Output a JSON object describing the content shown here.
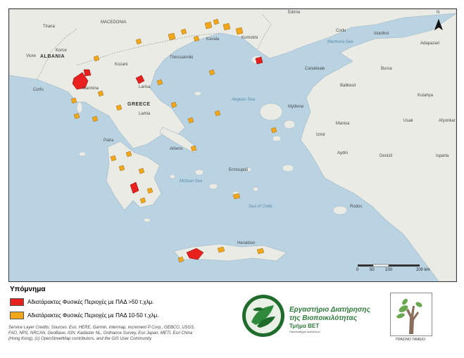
{
  "map": {
    "north_arrow": "N",
    "countries": {
      "albania": "ALBANIA",
      "greece": "GREECE"
    },
    "seas": [
      "Marmara Sea",
      "Aegean Sea",
      "Mirtoan Sea",
      "Sea of Crete"
    ],
    "places": [
      "Edirne",
      "MACEDONIA",
      "Tirana",
      "Istanbul",
      "Corlu",
      "Komotini",
      "Kavala",
      "Thessaloniki",
      "Adapazari",
      "Bursa",
      "Canakkale",
      "Balikesir",
      "Kutahya",
      "Usak",
      "Afyonkar",
      "Izmir",
      "Mytilene",
      "Manisa",
      "Aydin",
      "Denizli",
      "Isparta",
      "Larisa",
      "Lamia",
      "Korce",
      "Vlore",
      "Ioannina",
      "Corfu",
      "Kozani",
      "Patra",
      "Athens",
      "Ermoupoli",
      "Rodos",
      "Heraklion"
    ],
    "scale": {
      "labels": [
        "0",
        "50",
        "100",
        "200 km"
      ]
    }
  },
  "legend": {
    "title": "Υπόμνημα",
    "items": [
      {
        "label": "Αδιατάρακτες Φυσικές Περιοχές με ΠΑΔ >50 τ.χλμ.",
        "color": "#e8201e"
      },
      {
        "label": "Αδιατάρακτες Φυσικές Περιοχές με ΠΑΔ 10-50 τ.χλμ.",
        "color": "#f2a71b"
      }
    ]
  },
  "credits": "Service Layer Credits: Sources: Esri, HERE, Garmin, Intermap, increment P Corp., GEBCO, USGS, FAO, NPS, NRCAN, GeoBase, IGN, Kadaster NL, Ordnance Survey, Esri Japan, METI, Esri China (Hong Kong), (c) OpenStreetMap contributors, and the GIS User Community",
  "lab": {
    "line1": "Εργαστήριο Διατήρησης",
    "line2": "της Βιοποικιλότητας",
    "line3": "Τμήμα ΒΕΤ",
    "line4": "Πανεπιστήμιο Ιωαννίνων"
  },
  "green_fund": "ΠΡΑΣΙΝΟ ΤΑΜΕΙΟ",
  "colors": {
    "sea": "#b9d3e3",
    "land": "#e9ebe4",
    "large_area": "#e8201e",
    "medium_area": "#f2a71b"
  }
}
